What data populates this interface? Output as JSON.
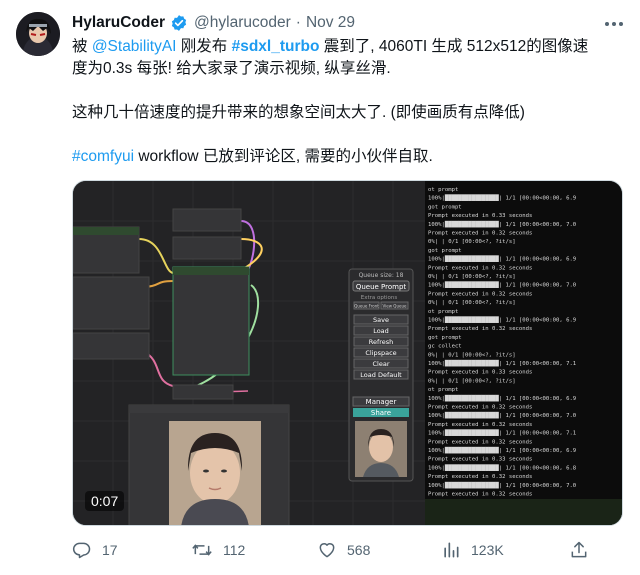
{
  "author": {
    "name": "HylaruCoder",
    "handle": "@hylarucoder",
    "separator": "·",
    "date": "Nov 29"
  },
  "tweet": {
    "line1": {
      "p1": "被 ",
      "mention": "@StabilityAI",
      "p2": " 刚发布 ",
      "hashtag": "#sdxl_turbo",
      "p3": " 震到了, 4060TI 生成 512x512的图像速"
    },
    "line2": "度为0.3s 每张! 给大家录了演示视频, 纵享丝滑.",
    "line3": "这种几十倍速度的提升带来的想象空间太大了. (即使画质有点降低)",
    "line4": {
      "hashtag": "#comfyui",
      "rest": " workflow 已放到评论区, 需要的小伙伴自取."
    }
  },
  "video": {
    "timestamp": "0:07",
    "queue_panel": {
      "queue_size": "Queue size: 18",
      "queue_button": "Queue Prompt",
      "extra_options": "Extra options",
      "queue_front": "Queue Front",
      "view_queue": "View Queue",
      "buttons": [
        "Save",
        "Load",
        "Refresh",
        "Clipspace",
        "Clear",
        "Load Default"
      ],
      "manager": "Manager",
      "share": "Share"
    },
    "terminal_lines": [
      "ot prompt",
      "100%|████████████████| 1/1 [00:00<00:00, 6.9",
      "got prompt",
      "Prompt executed in 0.33 seconds",
      "100%|████████████████| 1/1 [00:00<00:00, 7.0",
      "Prompt executed in 0.32 seconds",
      "  0%|                | 0/1 [00:00<?, ?it/s]",
      "got prompt",
      "100%|████████████████| 1/1 [00:00<00:00, 6.9",
      "Prompt executed in 0.32 seconds",
      "  0%|                | 0/1 [00:00<?, ?it/s]",
      "100%|████████████████| 1/1 [00:00<00:00, 7.0",
      "Prompt executed in 0.32 seconds",
      "  0%|                | 0/1 [00:00<?, ?it/s]",
      "ot prompt",
      "100%|████████████████| 1/1 [00:00<00:00, 6.9",
      "Prompt executed in 0.32 seconds",
      "got prompt",
      "gc collect",
      "  0%|                | 0/1 [00:00<?, ?it/s]",
      "100%|████████████████| 1/1 [00:00<00:00, 7.1",
      "Prompt executed in 0.33 seconds",
      "  0%|                | 0/1 [00:00<?, ?it/s]",
      "ot prompt",
      "100%|████████████████| 1/1 [00:00<00:00, 6.9",
      "Prompt executed in 0.32 seconds",
      "100%|████████████████| 1/1 [00:00<00:00, 7.0",
      "Prompt executed in 0.32 seconds",
      "100%|████████████████| 1/1 [00:00<00:00, 7.1",
      "Prompt executed in 0.32 seconds",
      "100%|████████████████| 1/1 [00:00<00:00, 6.9",
      "Prompt executed in 0.33 seconds",
      "100%|████████████████| 1/1 [00:00<00:00, 6.8",
      "Prompt executed in 0.32 seconds",
      "100%|████████████████| 1/1 [00:00<00:00, 7.0",
      "Prompt executed in 0.32 seconds"
    ]
  },
  "actions": {
    "replies": "17",
    "retweets": "112",
    "likes": "568",
    "views": "123K"
  },
  "colors": {
    "link": "#1d9bf0",
    "verified": "#1d9bf0",
    "muted": "#536471"
  }
}
